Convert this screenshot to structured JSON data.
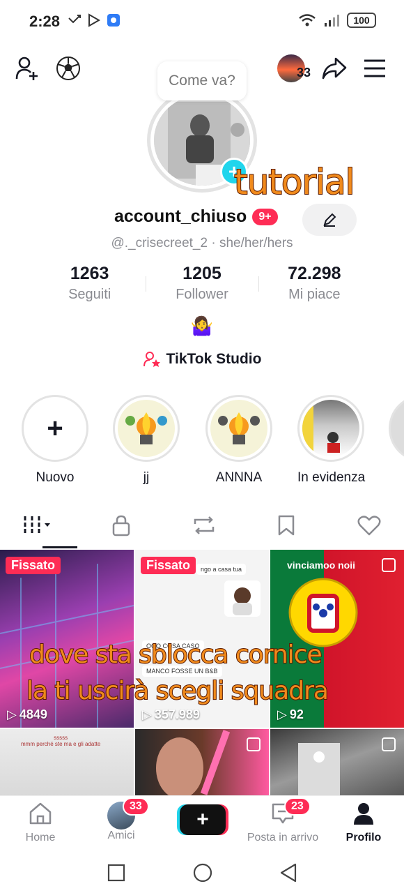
{
  "status_bar": {
    "time": "2:28",
    "battery": "100"
  },
  "top_bar": {
    "speech_bubble": "Come va?",
    "friends_count": "33"
  },
  "overlay": {
    "tutorial": "tutorial",
    "line1": "dove sta sblocca cornice",
    "line2": "la ti uscirà scegli squadra"
  },
  "profile": {
    "username": "account_chiuso",
    "badge": "9+",
    "handle": "@._crisecreet_2 · she/her/hers",
    "stats": [
      {
        "value": "1263",
        "label": "Seguiti"
      },
      {
        "value": "1205",
        "label": "Follower"
      },
      {
        "value": "72.298",
        "label": "Mi piace"
      }
    ],
    "bio_emoji": "🤷‍♀️",
    "studio_label": "TikTok Studio"
  },
  "highlights": [
    {
      "label": "Nuovo"
    },
    {
      "label": "jj"
    },
    {
      "label": "ANNNA"
    },
    {
      "label": "In evidenza"
    }
  ],
  "videos": [
    {
      "pinned": "Fissato",
      "views": "4849"
    },
    {
      "pinned": "Fissato",
      "views": "357.989",
      "chat_lines": [
        "ngo a casa tua",
        "OOO COSA CASO",
        "MANCO FOSSE UN B&B"
      ]
    },
    {
      "views": "92",
      "caption": "vinciamoo noii"
    },
    {
      "caption": "sssss\nmmm perché ste ma e gli adatte"
    },
    {},
    {}
  ],
  "bottom_nav": {
    "home": "Home",
    "friends": "Amici",
    "friends_badge": "33",
    "inbox": "Posta in arrivo",
    "inbox_badge": "23",
    "profile": "Profilo"
  },
  "colors": {
    "accent": "#fe2c55",
    "cyan": "#20d5ec",
    "overlay_text": "#f08a1c"
  }
}
